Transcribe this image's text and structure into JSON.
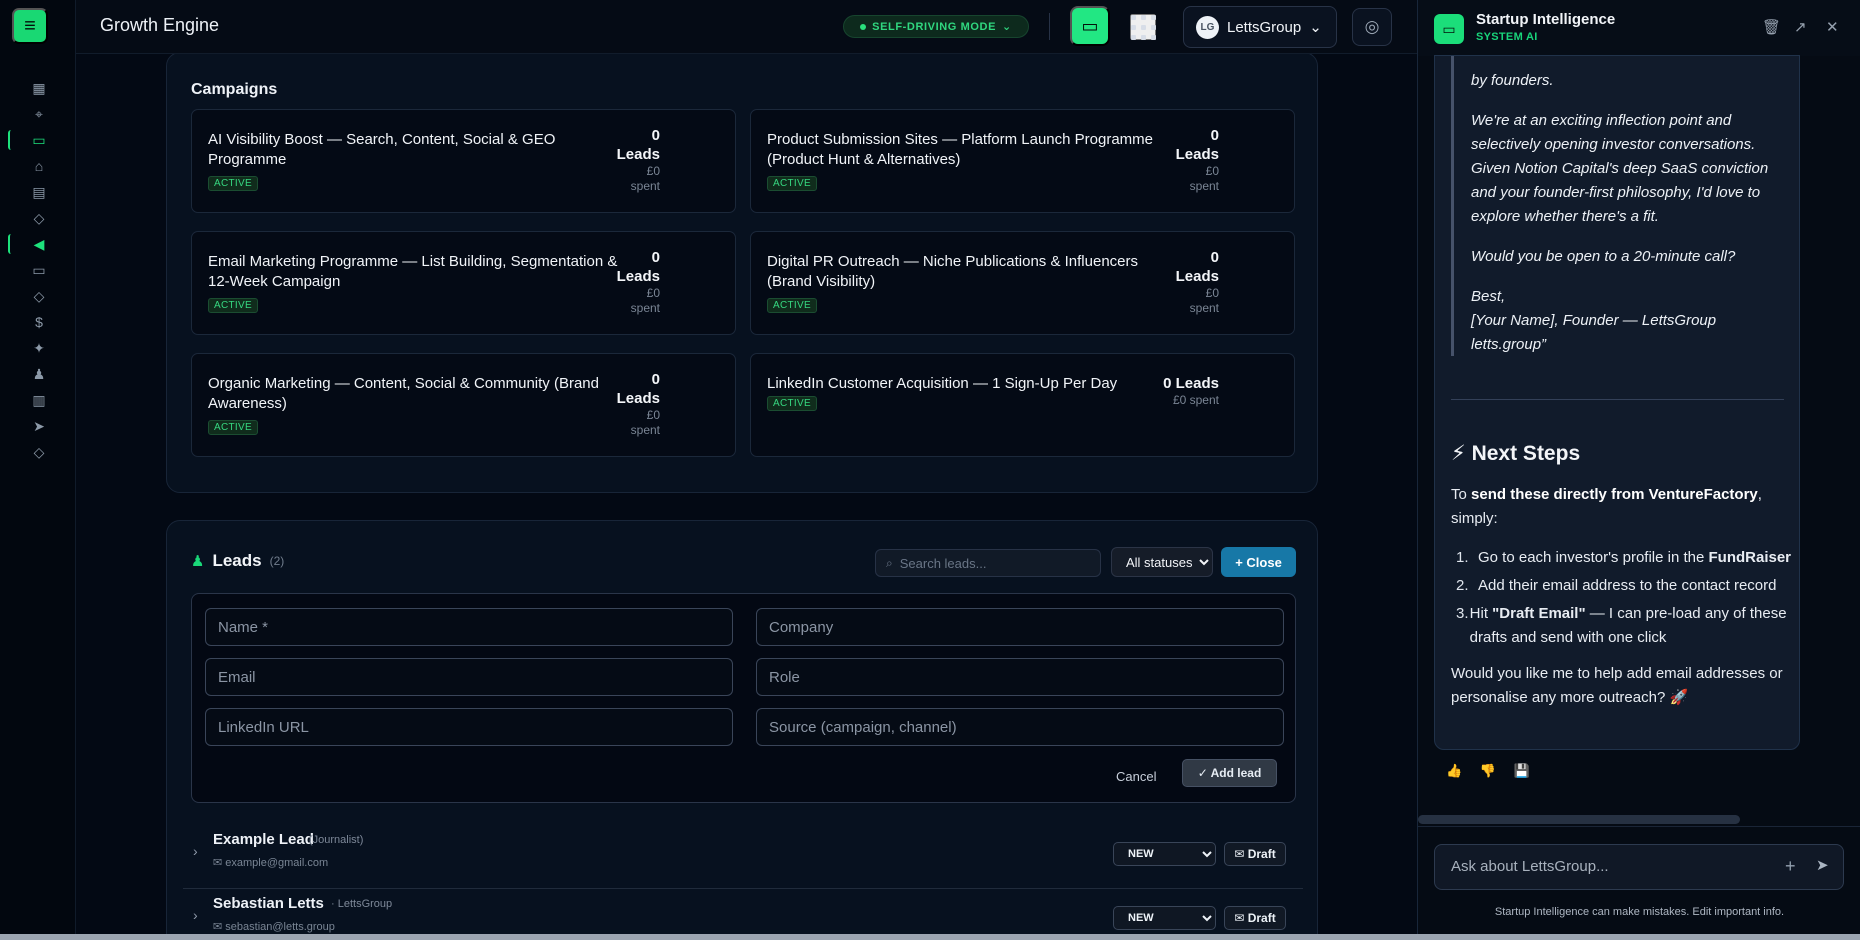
{
  "app": {
    "title": "Growth Engine",
    "mode_label": "SELF-DRIVING MODE",
    "org_name": "LettsGroup",
    "org_initials": "LG"
  },
  "sidebar": {
    "items": [
      {
        "icon": "dashboard-icon",
        "symbol": "▦",
        "active": false
      },
      {
        "icon": "rocket-icon",
        "symbol": "⌖",
        "active": false
      },
      {
        "icon": "message-icon",
        "symbol": "▭",
        "active": true
      },
      {
        "icon": "lock-icon",
        "symbol": "⌂",
        "active": false
      },
      {
        "icon": "document-icon",
        "symbol": "▤",
        "active": false
      },
      {
        "icon": "cube-icon",
        "symbol": "◇",
        "active": false
      },
      {
        "icon": "megaphone-icon",
        "symbol": "◀",
        "active": true
      },
      {
        "icon": "card-icon",
        "symbol": "▭",
        "active": false
      },
      {
        "icon": "shield-icon",
        "symbol": "◇",
        "active": false
      },
      {
        "icon": "dollar-icon",
        "symbol": "$",
        "active": false
      },
      {
        "icon": "sparkle-icon",
        "symbol": "✦",
        "active": false
      },
      {
        "icon": "users-icon",
        "symbol": "♟",
        "active": false
      },
      {
        "icon": "book-icon",
        "symbol": "▥",
        "active": false
      },
      {
        "icon": "send-icon",
        "symbol": "➤",
        "active": false
      },
      {
        "icon": "shield-check-icon",
        "symbol": "◇",
        "active": false
      }
    ]
  },
  "campaigns": {
    "title": "Campaigns",
    "items": [
      {
        "name": "AI Visibility Boost — Search, Content, Social & GEO Programme",
        "status": "ACTIVE",
        "leads": "0",
        "leads_label": "Leads",
        "spent": "£0",
        "spent_label": "spent"
      },
      {
        "name": "Product Submission Sites — Platform Launch Programme (Product Hunt & Alternatives)",
        "status": "ACTIVE",
        "leads": "0",
        "leads_label": "Leads",
        "spent": "£0",
        "spent_label": "spent"
      },
      {
        "name": "Email Marketing Programme — List Building, Segmentation & 12-Week Campaign",
        "status": "ACTIVE",
        "leads": "0",
        "leads_label": "Leads",
        "spent": "£0",
        "spent_label": "spent"
      },
      {
        "name": "Digital PR Outreach — Niche Publications & Influencers (Brand Visibility)",
        "status": "ACTIVE",
        "leads": "0",
        "leads_label": "Leads",
        "spent": "£0",
        "spent_label": "spent"
      },
      {
        "name": "Organic Marketing — Content, Social & Community (Brand Awareness)",
        "status": "ACTIVE",
        "leads": "0",
        "leads_label": "Leads",
        "spent": "£0",
        "spent_label": "spent"
      },
      {
        "name": "LinkedIn Customer Acquisition — 1 Sign-Up Per Day",
        "status": "ACTIVE",
        "leads_summary": "0 Leads",
        "spent_summary": "£0 spent"
      }
    ]
  },
  "leads": {
    "title": "Leads",
    "count": "(2)",
    "search_placeholder": "Search leads...",
    "status_filter": "All statuses",
    "close_label": "Close",
    "form": {
      "name_placeholder": "Name *",
      "company_placeholder": "Company",
      "email_placeholder": "Email",
      "role_placeholder": "Role",
      "linkedin_placeholder": "LinkedIn URL",
      "source_placeholder": "Source (campaign, channel)",
      "cancel_label": "Cancel",
      "add_label": "Add lead"
    },
    "rows": [
      {
        "name": "Example Lead",
        "meta": "(Journalist)",
        "email": "example@gmail.com",
        "status": "NEW",
        "draft_label": "Draft"
      },
      {
        "name": "Sebastian Letts",
        "meta": "· LettsGroup",
        "email": "sebastian@letts.group",
        "status": "NEW",
        "draft_label": "Draft"
      }
    ]
  },
  "assistant": {
    "title": "Startup Intelligence",
    "subtitle": "SYSTEM AI",
    "quote": {
      "line1": "by founders.",
      "para1": "We're at an exciting inflection point and selectively opening investor conversations. Given Notion Capital's deep SaaS conviction and your founder-first philosophy, I'd love to explore whether there's a fit.",
      "para2": "Would you be open to a 20-minute call?",
      "closing": "Best,",
      "signature": "[Your Name], Founder — LettsGroup",
      "site": "letts.group”"
    },
    "next_steps": {
      "heading": "⚡ Next Steps",
      "intro_prefix": "To",
      "intro_strong": "send these directly from VentureFactory",
      "intro_suffix": ", simply:",
      "step1_prefix": "Go to each investor's profile in the",
      "step1_strong": "FundRaiser",
      "step2": "Add their email address to the contact record",
      "step3_prefix": "Hit",
      "step3_strong": "\"Draft Email\"",
      "step3_suffix": " — I can pre-load any of these drafts and send with one click",
      "closing": "Would you like me to help add email addresses or personalise any more outreach? 🚀"
    },
    "input_placeholder": "Ask about LettsGroup...",
    "disclaimer": "Startup Intelligence can make mistakes. Edit important info."
  }
}
